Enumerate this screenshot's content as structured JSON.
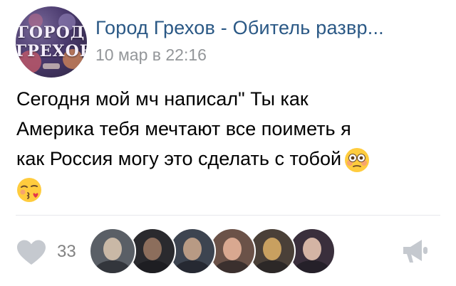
{
  "post": {
    "group": {
      "name": "Город Грехов - Обитель развр...",
      "avatar_text_line1": "ГОРОД",
      "avatar_text_line2": "ГРЕХОВ"
    },
    "date": "10 мар в 22:16",
    "text_lines": [
      "Сегодня мой мч написал\" Ты как",
      "Америка тебя мечтают все поиметь я",
      "как Россия могу это сделать с тобой"
    ],
    "emojis": [
      "flushed-face-icon",
      "face-blowing-kiss-icon"
    ]
  },
  "footer": {
    "likes_count": "33",
    "like_icon": "heart-icon",
    "share_icon": "megaphone-icon",
    "likers": [
      {
        "name": "liker-avatar-1",
        "bg": "#5a5f66",
        "face": "#c9b8a6"
      },
      {
        "name": "liker-avatar-2",
        "bg": "#2a2a2e",
        "face": "#8c6e5c"
      },
      {
        "name": "liker-avatar-3",
        "bg": "#3d4450",
        "face": "#b89a84"
      },
      {
        "name": "liker-avatar-4",
        "bg": "#6b5248",
        "face": "#d9a890"
      },
      {
        "name": "liker-avatar-5",
        "bg": "#4a4038",
        "face": "#c8a060"
      },
      {
        "name": "liker-avatar-6",
        "bg": "#3a2f3c",
        "face": "#d4b4a4"
      }
    ]
  },
  "colors": {
    "group_link": "#2a5885",
    "meta_gray": "#939699",
    "icon_gray": "#c5c9cf",
    "divider": "#e7e8ec"
  }
}
